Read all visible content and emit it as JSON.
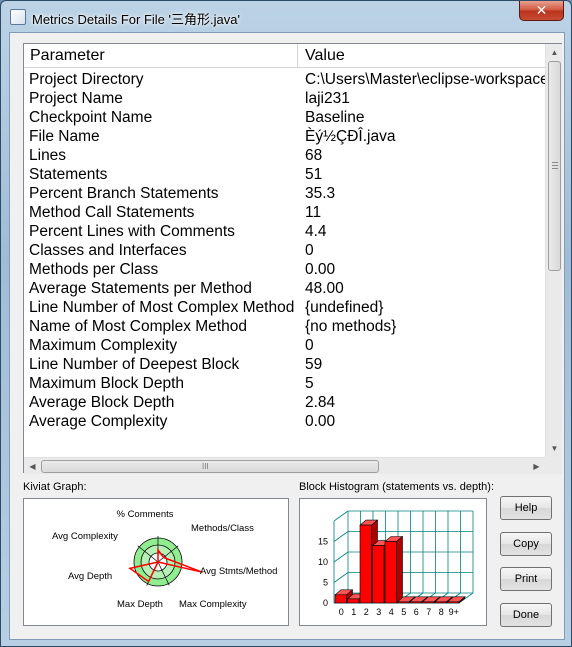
{
  "window": {
    "title": "Metrics Details For File '三角形.java'",
    "close_glyph": "✕"
  },
  "table": {
    "columns": {
      "parameter": "Parameter",
      "value": "Value"
    },
    "rows": [
      {
        "p": "Project Directory",
        "v": "C:\\Users\\Master\\eclipse-workspace"
      },
      {
        "p": "Project Name",
        "v": "laji231"
      },
      {
        "p": "Checkpoint Name",
        "v": "Baseline"
      },
      {
        "p": "File Name",
        "v": "Èý½ÇÐÎ.java"
      },
      {
        "p": "Lines",
        "v": "68"
      },
      {
        "p": "Statements",
        "v": "51"
      },
      {
        "p": "Percent Branch Statements",
        "v": "35.3"
      },
      {
        "p": "Method Call Statements",
        "v": "11"
      },
      {
        "p": "Percent Lines with Comments",
        "v": "4.4"
      },
      {
        "p": "Classes and Interfaces",
        "v": "0"
      },
      {
        "p": "Methods per Class",
        "v": "0.00"
      },
      {
        "p": "Average Statements per Method",
        "v": "48.00"
      },
      {
        "p": "Line Number of Most Complex Method",
        "v": "{undefined}"
      },
      {
        "p": "Name of Most Complex Method",
        "v": "{no methods}"
      },
      {
        "p": "Maximum Complexity",
        "v": "0"
      },
      {
        "p": "Line Number of Deepest Block",
        "v": "59"
      },
      {
        "p": "Maximum Block Depth",
        "v": "5"
      },
      {
        "p": "Average Block Depth",
        "v": "2.84"
      },
      {
        "p": "Average Complexity",
        "v": "0.00"
      }
    ]
  },
  "kiviat": {
    "label": "Kiviat Graph:",
    "axes": [
      "% Comments",
      "Methods/Class",
      "Avg Stmts/Method",
      "Max Complexity",
      "Max Depth",
      "Avg Depth",
      "Avg Complexity"
    ]
  },
  "histogram": {
    "label": "Block Histogram (statements vs. depth):",
    "x_labels": [
      "0",
      "1",
      "2",
      "3",
      "4",
      "5",
      "6",
      "7",
      "8",
      "9+"
    ],
    "y_ticks": [
      "0",
      "5",
      "10",
      "15"
    ],
    "values": [
      2,
      1,
      19,
      14,
      15,
      0,
      0,
      0,
      0,
      0
    ],
    "bar_color": "#ff0000",
    "grid_color": "#008080"
  },
  "buttons": {
    "help": "Help",
    "copy": "Copy",
    "print": "Print",
    "done": "Done"
  },
  "scroll": {
    "left": "◀",
    "right": "▶",
    "up": "▲",
    "down": "▼",
    "grip": "III"
  },
  "colors": {
    "kiviat_fill": "#90ee90",
    "kiviat_line": "#ff0000",
    "chrome": "#f0f0f0"
  }
}
